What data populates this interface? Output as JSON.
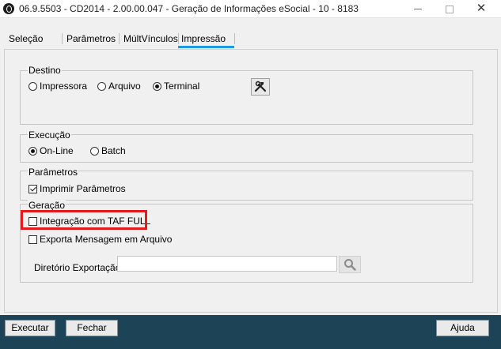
{
  "window": {
    "title": "06.9.5503 - CD2014 - 2.00.00.047 - Geração de Informações eSocial - 10 - 8183",
    "minimize": "—",
    "maximize": "☐",
    "close": "✕"
  },
  "tabs": [
    {
      "label": "Seleção",
      "active": false
    },
    {
      "label": "Parâmetros",
      "active": false
    },
    {
      "label": "MúltVínculos",
      "active": false
    },
    {
      "label": "Impressão",
      "active": true
    }
  ],
  "destino": {
    "title": "Destino",
    "options": [
      {
        "label": "Impressora",
        "selected": false
      },
      {
        "label": "Arquivo",
        "selected": false
      },
      {
        "label": "Terminal",
        "selected": true
      }
    ],
    "tool_icon": "wrench-hammer-icon"
  },
  "execucao": {
    "title": "Execução",
    "options": [
      {
        "label": "On-Line",
        "selected": true
      },
      {
        "label": "Batch",
        "selected": false
      }
    ]
  },
  "parametros": {
    "title": "Parâmetros",
    "imprimir_label": "Imprimir Parâmetros",
    "imprimir_checked": true
  },
  "geracao": {
    "title": "Geração",
    "integracao_label": "Integração com TAF FULL",
    "integracao_checked": false,
    "exporta_label": "Exporta Mensagem em Arquivo",
    "exporta_checked": false,
    "diretorio_label": "Diretório Exportação",
    "diretorio_value": "",
    "search_icon": "search-icon"
  },
  "footer": {
    "executar": "Executar",
    "fechar": "Fechar",
    "ajuda": "Ajuda"
  },
  "colors": {
    "footer_bg": "#1d4357",
    "tab_accent": "#1e9be0",
    "highlight": "#e21c1c"
  }
}
